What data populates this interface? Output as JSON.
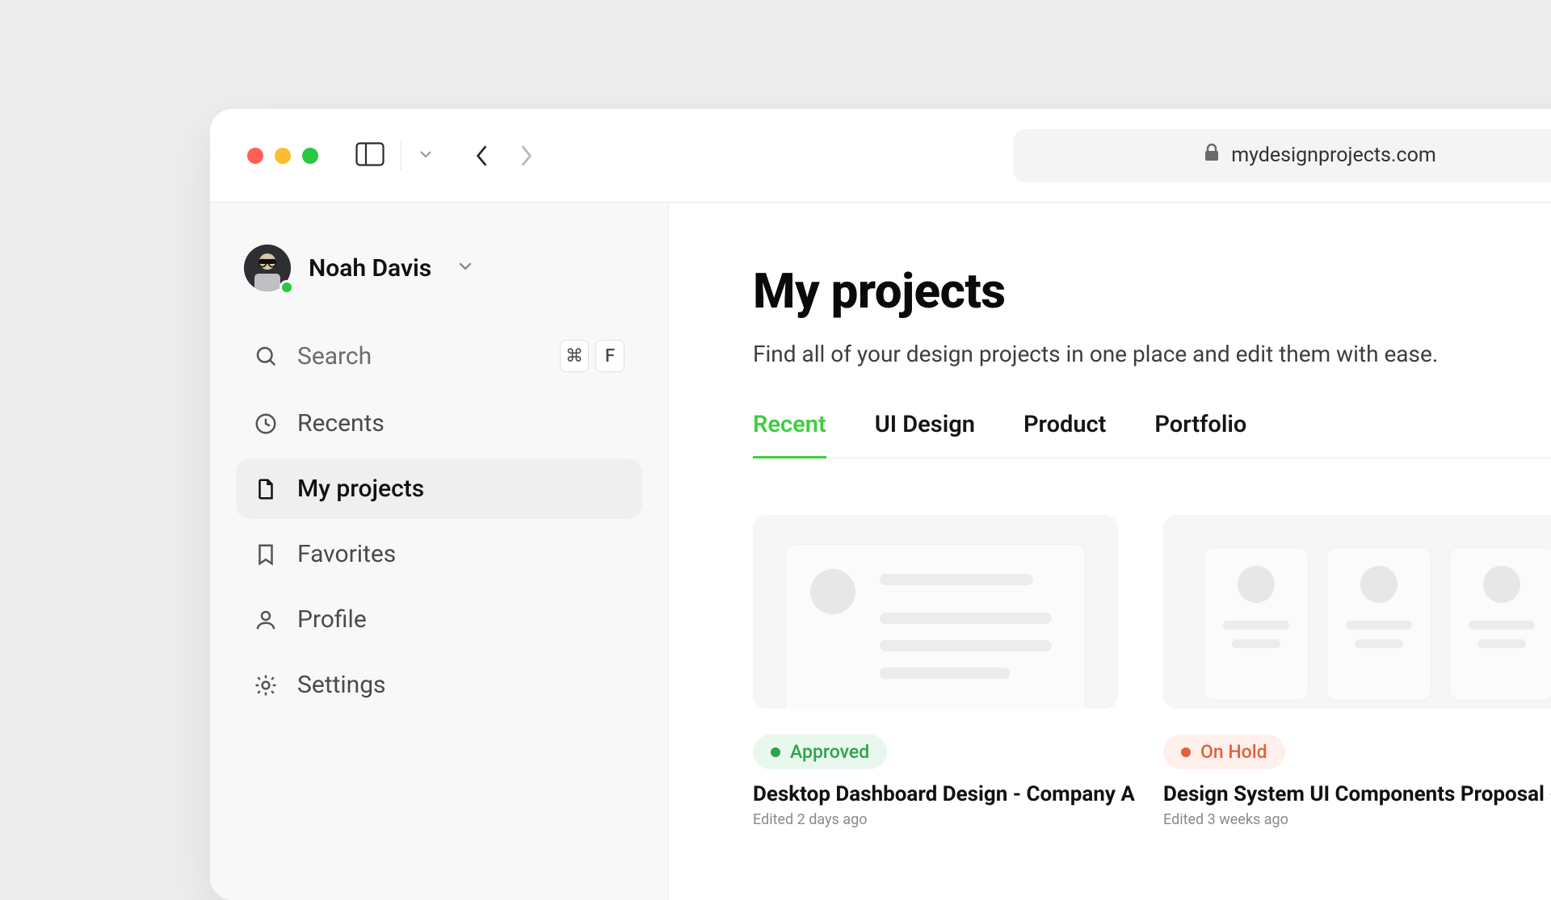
{
  "address": "mydesignprojects.com",
  "profile": {
    "name": "Noah Davis"
  },
  "search": {
    "label": "Search",
    "kbd": [
      "⌘",
      "F"
    ]
  },
  "sidebar": {
    "items": [
      {
        "label": "Recents"
      },
      {
        "label": "My projects"
      },
      {
        "label": "Favorites"
      },
      {
        "label": "Profile"
      },
      {
        "label": "Settings"
      }
    ]
  },
  "page": {
    "title": "My projects",
    "subtitle": "Find all of your design projects in one place and edit them with ease."
  },
  "tabs": [
    {
      "label": "Recent"
    },
    {
      "label": "UI Design"
    },
    {
      "label": "Product"
    },
    {
      "label": "Portfolio"
    }
  ],
  "projects": [
    {
      "status": "Approved",
      "title": "Desktop Dashboard Design - Company A",
      "meta": "Edited 2 days ago"
    },
    {
      "status": "On Hold",
      "title": "Design System UI Components  Proposal - C",
      "meta": "Edited 3 weeks ago"
    }
  ]
}
